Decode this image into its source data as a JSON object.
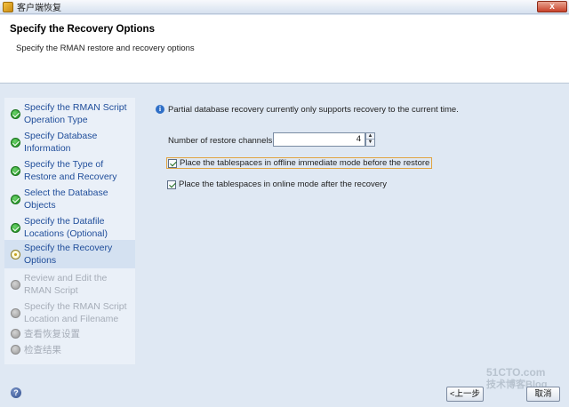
{
  "window": {
    "title": "客户端恢复",
    "close_label": "x"
  },
  "header": {
    "title": "Specify the Recovery Options",
    "subtitle": "Specify the RMAN restore and recovery options"
  },
  "nav": {
    "items": [
      {
        "label": "Specify the RMAN Script Operation Type",
        "state": "done"
      },
      {
        "label": "Specify Database Information",
        "state": "done"
      },
      {
        "label": "Specify the Type of Restore and Recovery",
        "state": "done"
      },
      {
        "label": "Select the Database Objects",
        "state": "done"
      },
      {
        "label": "Specify the Datafile Locations (Optional)",
        "state": "done"
      },
      {
        "label": "Specify the Recovery Options",
        "state": "current"
      },
      {
        "label": "Review and Edit the RMAN Script",
        "state": "pending"
      },
      {
        "label": "Specify the RMAN Script Location and Filename",
        "state": "pending"
      },
      {
        "label": "查看恢复设置",
        "state": "pending"
      },
      {
        "label": "检查结果",
        "state": "pending"
      }
    ]
  },
  "main": {
    "info_text": "Partial database recovery currently only supports recovery to the current time.",
    "channels_label": "Number of restore channels:",
    "channels_value": "4",
    "options": [
      {
        "label": "Place the tablespaces in offline immediate mode before the restore",
        "checked": true
      },
      {
        "label": "Place the tablespaces in online mode after the recovery",
        "checked": true
      }
    ]
  },
  "footer": {
    "back_label": "<上一步",
    "cancel_label": "取消"
  },
  "watermark": {
    "line1": "51CTO.com",
    "line2": "技术博客Blog"
  },
  "colors": {
    "nav_link": "#1f4d9a",
    "nav_dim": "#a6adb8",
    "focus_border": "#e0a442"
  }
}
